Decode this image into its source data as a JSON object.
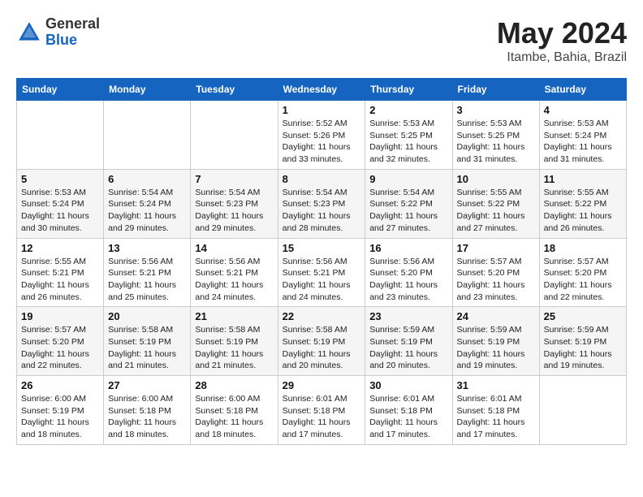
{
  "logo": {
    "general": "General",
    "blue": "Blue"
  },
  "title": {
    "month": "May 2024",
    "location": "Itambe, Bahia, Brazil"
  },
  "headers": [
    "Sunday",
    "Monday",
    "Tuesday",
    "Wednesday",
    "Thursday",
    "Friday",
    "Saturday"
  ],
  "weeks": [
    [
      {
        "day": "",
        "info": ""
      },
      {
        "day": "",
        "info": ""
      },
      {
        "day": "",
        "info": ""
      },
      {
        "day": "1",
        "sunrise": "Sunrise: 5:52 AM",
        "sunset": "Sunset: 5:26 PM",
        "daylight": "Daylight: 11 hours and 33 minutes."
      },
      {
        "day": "2",
        "sunrise": "Sunrise: 5:53 AM",
        "sunset": "Sunset: 5:25 PM",
        "daylight": "Daylight: 11 hours and 32 minutes."
      },
      {
        "day": "3",
        "sunrise": "Sunrise: 5:53 AM",
        "sunset": "Sunset: 5:25 PM",
        "daylight": "Daylight: 11 hours and 31 minutes."
      },
      {
        "day": "4",
        "sunrise": "Sunrise: 5:53 AM",
        "sunset": "Sunset: 5:24 PM",
        "daylight": "Daylight: 11 hours and 31 minutes."
      }
    ],
    [
      {
        "day": "5",
        "sunrise": "Sunrise: 5:53 AM",
        "sunset": "Sunset: 5:24 PM",
        "daylight": "Daylight: 11 hours and 30 minutes."
      },
      {
        "day": "6",
        "sunrise": "Sunrise: 5:54 AM",
        "sunset": "Sunset: 5:24 PM",
        "daylight": "Daylight: 11 hours and 29 minutes."
      },
      {
        "day": "7",
        "sunrise": "Sunrise: 5:54 AM",
        "sunset": "Sunset: 5:23 PM",
        "daylight": "Daylight: 11 hours and 29 minutes."
      },
      {
        "day": "8",
        "sunrise": "Sunrise: 5:54 AM",
        "sunset": "Sunset: 5:23 PM",
        "daylight": "Daylight: 11 hours and 28 minutes."
      },
      {
        "day": "9",
        "sunrise": "Sunrise: 5:54 AM",
        "sunset": "Sunset: 5:22 PM",
        "daylight": "Daylight: 11 hours and 27 minutes."
      },
      {
        "day": "10",
        "sunrise": "Sunrise: 5:55 AM",
        "sunset": "Sunset: 5:22 PM",
        "daylight": "Daylight: 11 hours and 27 minutes."
      },
      {
        "day": "11",
        "sunrise": "Sunrise: 5:55 AM",
        "sunset": "Sunset: 5:22 PM",
        "daylight": "Daylight: 11 hours and 26 minutes."
      }
    ],
    [
      {
        "day": "12",
        "sunrise": "Sunrise: 5:55 AM",
        "sunset": "Sunset: 5:21 PM",
        "daylight": "Daylight: 11 hours and 26 minutes."
      },
      {
        "day": "13",
        "sunrise": "Sunrise: 5:56 AM",
        "sunset": "Sunset: 5:21 PM",
        "daylight": "Daylight: 11 hours and 25 minutes."
      },
      {
        "day": "14",
        "sunrise": "Sunrise: 5:56 AM",
        "sunset": "Sunset: 5:21 PM",
        "daylight": "Daylight: 11 hours and 24 minutes."
      },
      {
        "day": "15",
        "sunrise": "Sunrise: 5:56 AM",
        "sunset": "Sunset: 5:21 PM",
        "daylight": "Daylight: 11 hours and 24 minutes."
      },
      {
        "day": "16",
        "sunrise": "Sunrise: 5:56 AM",
        "sunset": "Sunset: 5:20 PM",
        "daylight": "Daylight: 11 hours and 23 minutes."
      },
      {
        "day": "17",
        "sunrise": "Sunrise: 5:57 AM",
        "sunset": "Sunset: 5:20 PM",
        "daylight": "Daylight: 11 hours and 23 minutes."
      },
      {
        "day": "18",
        "sunrise": "Sunrise: 5:57 AM",
        "sunset": "Sunset: 5:20 PM",
        "daylight": "Daylight: 11 hours and 22 minutes."
      }
    ],
    [
      {
        "day": "19",
        "sunrise": "Sunrise: 5:57 AM",
        "sunset": "Sunset: 5:20 PM",
        "daylight": "Daylight: 11 hours and 22 minutes."
      },
      {
        "day": "20",
        "sunrise": "Sunrise: 5:58 AM",
        "sunset": "Sunset: 5:19 PM",
        "daylight": "Daylight: 11 hours and 21 minutes."
      },
      {
        "day": "21",
        "sunrise": "Sunrise: 5:58 AM",
        "sunset": "Sunset: 5:19 PM",
        "daylight": "Daylight: 11 hours and 21 minutes."
      },
      {
        "day": "22",
        "sunrise": "Sunrise: 5:58 AM",
        "sunset": "Sunset: 5:19 PM",
        "daylight": "Daylight: 11 hours and 20 minutes."
      },
      {
        "day": "23",
        "sunrise": "Sunrise: 5:59 AM",
        "sunset": "Sunset: 5:19 PM",
        "daylight": "Daylight: 11 hours and 20 minutes."
      },
      {
        "day": "24",
        "sunrise": "Sunrise: 5:59 AM",
        "sunset": "Sunset: 5:19 PM",
        "daylight": "Daylight: 11 hours and 19 minutes."
      },
      {
        "day": "25",
        "sunrise": "Sunrise: 5:59 AM",
        "sunset": "Sunset: 5:19 PM",
        "daylight": "Daylight: 11 hours and 19 minutes."
      }
    ],
    [
      {
        "day": "26",
        "sunrise": "Sunrise: 6:00 AM",
        "sunset": "Sunset: 5:19 PM",
        "daylight": "Daylight: 11 hours and 18 minutes."
      },
      {
        "day": "27",
        "sunrise": "Sunrise: 6:00 AM",
        "sunset": "Sunset: 5:18 PM",
        "daylight": "Daylight: 11 hours and 18 minutes."
      },
      {
        "day": "28",
        "sunrise": "Sunrise: 6:00 AM",
        "sunset": "Sunset: 5:18 PM",
        "daylight": "Daylight: 11 hours and 18 minutes."
      },
      {
        "day": "29",
        "sunrise": "Sunrise: 6:01 AM",
        "sunset": "Sunset: 5:18 PM",
        "daylight": "Daylight: 11 hours and 17 minutes."
      },
      {
        "day": "30",
        "sunrise": "Sunrise: 6:01 AM",
        "sunset": "Sunset: 5:18 PM",
        "daylight": "Daylight: 11 hours and 17 minutes."
      },
      {
        "day": "31",
        "sunrise": "Sunrise: 6:01 AM",
        "sunset": "Sunset: 5:18 PM",
        "daylight": "Daylight: 11 hours and 17 minutes."
      },
      {
        "day": "",
        "info": ""
      }
    ]
  ]
}
